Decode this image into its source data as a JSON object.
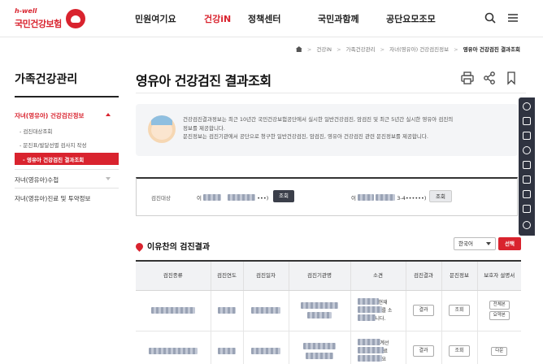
{
  "header": {
    "logo_en": "h-well",
    "logo_ko": "국민건강보험",
    "nav": [
      {
        "label": "민원여기요"
      },
      {
        "label": "건강iN"
      },
      {
        "label": "정책센터"
      },
      {
        "label": "국민과함께"
      },
      {
        "label": "공단요모조모"
      }
    ],
    "active_nav": "건강iN",
    "icons": [
      "search-icon",
      "menu-icon"
    ]
  },
  "breadcrumb": [
    "건강iN",
    "가족건강관리",
    "자녀(영유아) 건강검진정보",
    "영유아 건강검진 결과조회"
  ],
  "sidebar": {
    "title": "가족건강관리",
    "items": [
      {
        "label": "자녀(영유아) 건강검진정보",
        "open": true
      },
      {
        "label": "자녀(영유아)수첩",
        "open": false
      },
      {
        "label": "자녀(영유아)진료 및 투약정보",
        "open": false
      }
    ],
    "subitems": [
      {
        "label": "검진대상조회"
      },
      {
        "label": "문진표/발달선별 검사지 작성"
      },
      {
        "label": "영유아 건강검진 결과조회",
        "active": true
      }
    ]
  },
  "main": {
    "title": "영유아 건강검진 결과조회",
    "tools": [
      "print-icon",
      "share-icon",
      "bookmark-icon"
    ],
    "info_lines": [
      "건강검진결과정보는 최근 10년간 국민건강보험공단에서 실시한 일반건강검진, 암검진 및 최근 5년간 실시한 영유아 검진의",
      "정보를 제공합니다.",
      "문진정보는 검진기관에서 공단으로 청구한 일반건강검진, 암검진, 영유아 건강검진 관련 문진정보를 제공합니다."
    ],
    "target": {
      "label": "검진대상",
      "name1_prefix": "이",
      "name1_suffix": "•••)",
      "button1": "조회",
      "name2_prefix": "이",
      "name2_suffix": "3-4••••••)",
      "button2": "조회"
    },
    "results_title": "이유찬의 검진결과",
    "language": "한국어",
    "select_button": "선택",
    "table": {
      "headers": [
        "검진종류",
        "검진연도",
        "검진일자",
        "검진기관명",
        "소견",
        "검진결과",
        "문진정보",
        "보호자 설명서"
      ],
      "rows": [
        {
          "opinion": [
            "현재",
            "를 소",
            "니다."
          ],
          "result_btn": "결과",
          "survey_btn": "조회",
          "guide_btns": [
            "전체본",
            "요약본"
          ]
        },
        {
          "opinion": [
            "계선",
            "료",
            "요"
          ],
          "result_btn": "결과",
          "survey_btn": "조회",
          "guide_btns": [
            "다운"
          ]
        }
      ]
    }
  },
  "quickbar": {
    "icons": [
      "user-icon",
      "document-icon",
      "checklist-icon",
      "phone-icon",
      "lock-icon",
      "calendar-icon",
      "form-icon",
      "copy-icon",
      "chat-icon"
    ]
  },
  "colors": {
    "brand": "#d9232e",
    "dark": "#3b3f4a",
    "quickbar": "#2f3340"
  }
}
